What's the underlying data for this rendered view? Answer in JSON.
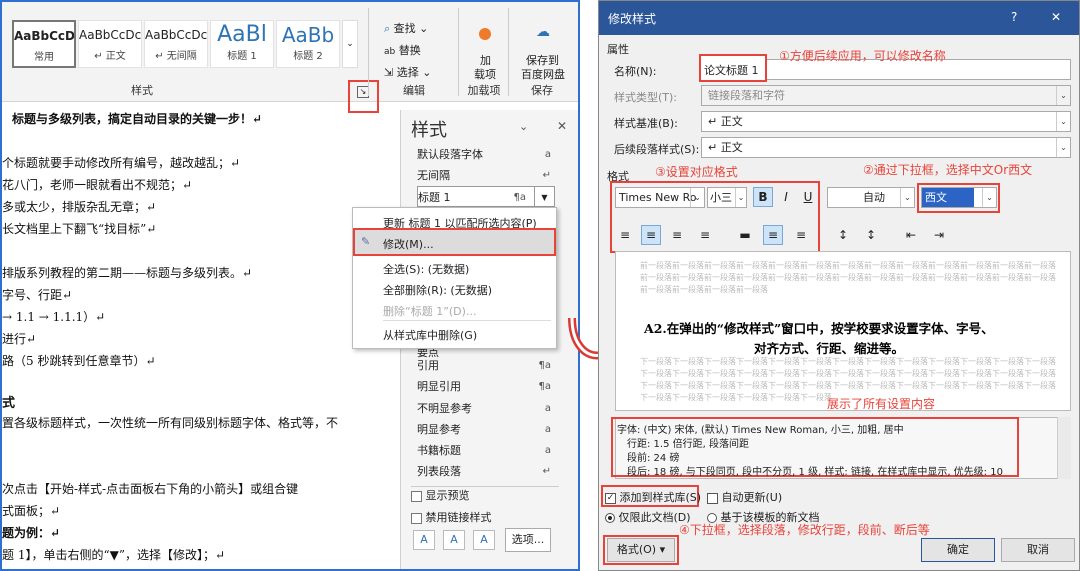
{
  "left": {
    "style_gallery": [
      {
        "preview": "AaBbCcD",
        "name": "常用"
      },
      {
        "preview": "AaBbCcDc",
        "name": "↵ 正文"
      },
      {
        "preview": "AaBbCcDc",
        "name": "↵ 无间隔"
      },
      {
        "preview": "AaBl",
        "name": "标题 1"
      },
      {
        "preview": "AaBb",
        "name": "标题 2"
      }
    ],
    "styles_group_label": "样式",
    "editing": {
      "find": "查找",
      "replace": "替换",
      "select": "选择",
      "label": "编辑"
    },
    "addin": {
      "label1": "加",
      "label2": "载项",
      "group": "加载项"
    },
    "save": {
      "label1": "保存到",
      "label2": "百度网盘",
      "group": "保存"
    },
    "doc_lines": [
      "标题与多级列表，搞定自动目录的关键一步！↵",
      "个标题就要手动修改所有编号，越改越乱；↵",
      "花八门，老师一眼就看出不规范；↵",
      "多或太少，排版杂乱无章；↵",
      "长文档里上下翻飞“找目标”↵",
      "排版系列教程的第二期——标题与多级列表。↵",
      "字号、行距↵",
      "→ 1.1 → 1.1.1）↵",
      "进行↵",
      "路（5 秒跳转到任意章节）↵",
      "式",
      "置各级标题样式，一次性统一所有同级别标题字体、格式等，不",
      "次点击【开始-样式-点击面板右下角的小箭头】或组合键",
      "式面板；↵",
      "题为例：↵",
      "题 1】，单击右侧的“▼”，选择【修改】；↵"
    ],
    "pane": {
      "title": "样式",
      "items": [
        {
          "label": "默认段落字体",
          "mark": "a"
        },
        {
          "label": "无间隔",
          "mark": "↵"
        },
        {
          "label": "标题 1",
          "mark": "¶a"
        },
        {
          "label": "要点",
          "mark": ""
        },
        {
          "label": "引用",
          "mark": "¶a"
        },
        {
          "label": "明显引用",
          "mark": "¶a"
        },
        {
          "label": "不明显参考",
          "mark": "a"
        },
        {
          "label": "明显参考",
          "mark": "a"
        },
        {
          "label": "书籍标题",
          "mark": "a"
        },
        {
          "label": "列表段落",
          "mark": "↵"
        }
      ],
      "show_preview": "显示预览",
      "disable_linked": "禁用链接样式",
      "options": "选项..."
    },
    "context_menu": [
      "更新 标题 1 以匹配所选内容(P)",
      "修改(M)...",
      "全选(S): (无数据)",
      "全部删除(R): (无数据)",
      "删除“标题 1”(D)...",
      "从样式库中删除(G)"
    ]
  },
  "dialog": {
    "title": "修改样式",
    "help": "?",
    "close": "✕",
    "attr_section": "属性",
    "name_label": "名称(N):",
    "name_value": "论文标题 1",
    "type_label": "样式类型(T):",
    "type_value": "链接段落和字符",
    "based_label": "样式基准(B):",
    "based_value": "↵ 正文",
    "next_label": "后续段落样式(S):",
    "next_value": "↵ 正文",
    "format_section": "格式",
    "font_value": "Times New Ro",
    "size_value": "小三",
    "bold": "B",
    "italic": "I",
    "underline": "U",
    "color_value": "自动",
    "script_value": "西文",
    "preview_prev": "前一段落前一段落前一段落前一段落前一段落前一段落前一段落前一段落前一段落前一段落前一段落前一段落前一段落前一段落前一段落前一段落前一段落前一段落前一段落前一段落前一段落前一段落前一段落前一段落前一段落前一段落前一段落前一段落前一段落前一段落",
    "preview_sample_1": "A2.在弹出的“修改样式”窗口中，按学校要求设置字体、字号、",
    "preview_sample_2": "对齐方式、行距、缩进等。",
    "preview_next": "下一段落下一段落下一段落下一段落下一段落下一段落下一段落下一段落下一段落下一段落下一段落下一段落下一段落下一段落下一段落下一段落下一段落下一段落下一段落下一段落下一段落下一段落下一段落下一段落下一段落下一段落下一段落下一段落下一段落下一段落下一段落下一段落下一段落下一段落下一段落下一段落下一段落下一段落下一段落下一段落下一段落下一段落下一段落下一段落下一段落",
    "desc_lines": [
      "字体: (中文) 宋体, (默认) Times New Roman, 小三, 加粗, 居中",
      "行距: 1.5 倍行距, 段落间距",
      "段前: 24 磅",
      "段后: 18 磅, 与下段同页, 段中不分页, 1 级, 样式: 链接, 在样式库中显示, 优先级: 10"
    ],
    "add_to_gallery": "添加到样式库(S)",
    "auto_update": "自动更新(U)",
    "only_doc": "仅限此文档(D)",
    "new_docs": "基于该模板的新文档",
    "format_btn": "格式(O) ▾",
    "ok": "确定",
    "cancel": "取消"
  },
  "annotations": {
    "a1": "①方便后续应用，可以修改名称",
    "a2": "②通过下拉框，选择中文Or西文",
    "a3": "③设置对应格式",
    "a4": "④下拉框，选择段落，修改行距，段前、断后等",
    "a5": "展示了所有设置内容"
  },
  "colors": {
    "accent": "#2b579a",
    "annotation": "#e8433a",
    "arrow": "#d93a32"
  }
}
